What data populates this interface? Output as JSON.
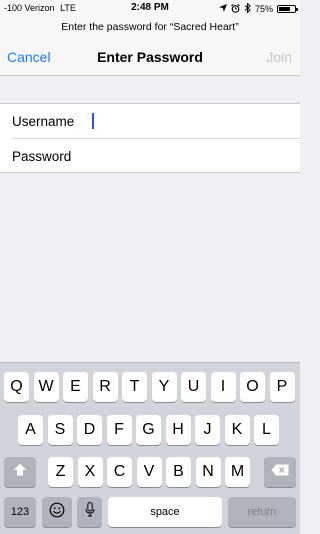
{
  "status": {
    "carrier": "-100 Verizon",
    "network": "LTE",
    "time": "2:48 PM",
    "battery": "75%",
    "battery_level": 0.75,
    "icons": [
      "location-arrow-icon",
      "alarm-icon",
      "bluetooth-icon",
      "battery-icon"
    ]
  },
  "prompt": "Enter the password for “Sacred Heart”",
  "nav": {
    "cancel_label": "Cancel",
    "title": "Enter Password",
    "join_label": "Join"
  },
  "form": {
    "username_label": "Username",
    "username_value": "",
    "password_label": "Password",
    "password_value": ""
  },
  "keyboard": {
    "row1": [
      "Q",
      "W",
      "E",
      "R",
      "T",
      "Y",
      "U",
      "I",
      "O",
      "P"
    ],
    "row2": [
      "A",
      "S",
      "D",
      "F",
      "G",
      "H",
      "J",
      "K",
      "L"
    ],
    "row3": [
      "Z",
      "X",
      "C",
      "V",
      "B",
      "N",
      "M"
    ],
    "numbers_label": "123",
    "space_label": "space",
    "return_label": "return",
    "icons": [
      "shift-icon",
      "backspace-icon",
      "emoji-icon",
      "microphone-icon"
    ]
  },
  "colors": {
    "accent": "#1a7cf6",
    "disabled": "#c7c7cc",
    "caret": "#1f5bd8",
    "keyboard_bg": "#d1d5db"
  }
}
